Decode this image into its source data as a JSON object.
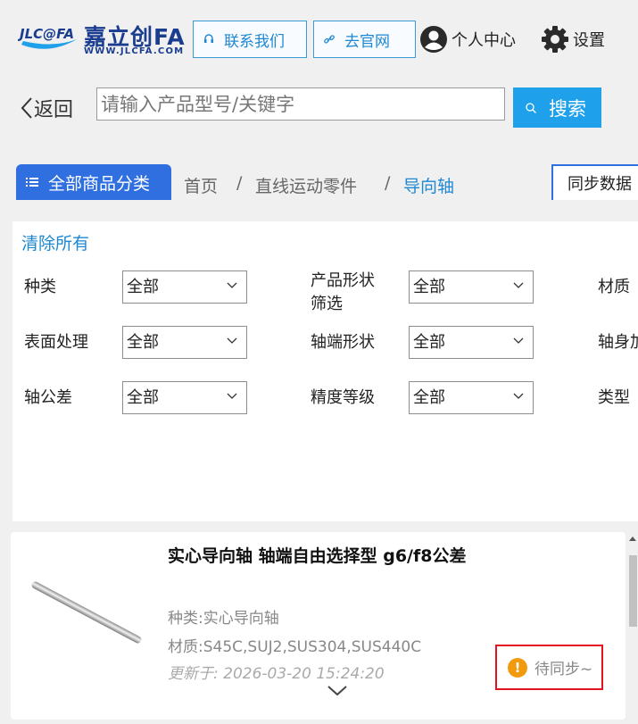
{
  "header": {
    "logo_text": "嘉立创FA",
    "logo_badge": "JLC@FA",
    "logo_url": "WWW.JLCFA.COM",
    "contact_label": "联系我们",
    "official_label": "去官网",
    "user_label": "个人中心",
    "settings_label": "设置"
  },
  "search": {
    "back_label": "返回",
    "placeholder": "请输入产品型号/关键字",
    "button_label": "搜索"
  },
  "nav": {
    "categories_label": "全部商品分类",
    "breadcrumb": [
      "首页",
      "直线运动零件",
      "导向轴"
    ],
    "separator": "/",
    "sync_label": "同步数据"
  },
  "filters": {
    "clear_label": "清除所有",
    "items": [
      {
        "label": "种类",
        "value": "全部"
      },
      {
        "label": "产品形状筛选",
        "label_line1": "产品形状",
        "label_line2": "筛选",
        "value": "全部"
      },
      {
        "label": "材质"
      },
      {
        "label": "表面处理",
        "value": "全部"
      },
      {
        "label": "轴端形状",
        "value": "全部"
      },
      {
        "label": "轴身",
        "label_visible": "轴身加"
      },
      {
        "label": "轴公差",
        "value": "全部"
      },
      {
        "label": "精度等级",
        "value": "全部"
      },
      {
        "label": "类型"
      }
    ]
  },
  "product": {
    "title": "实心导向轴  轴端自由选择型 g6/f8公差",
    "type_line": "种类:实心导向轴",
    "material_line": "材质:S45C,SUJ2,SUS304,SUS440C",
    "updated_line": "更新于:  2026-03-20 15:24:20",
    "status_label": "待同步~",
    "status_icon": "!"
  },
  "colors": {
    "accent_blue": "#1ea0ea",
    "category_blue": "#2f6fe0",
    "link_blue": "#1e88d2",
    "pending_orange": "#f29a0e",
    "highlight_red": "#e3141f"
  }
}
